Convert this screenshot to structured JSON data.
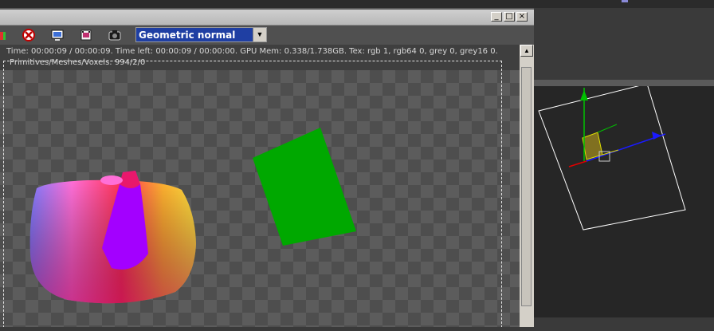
{
  "toolbar": {
    "display_mode": "Geometric normal",
    "icons": [
      "teapot-icon",
      "no-entry-icon",
      "monitor-icon",
      "film-clip-icon",
      "camera-icon"
    ]
  },
  "stats": {
    "line1": "Time: 00:00:09 / 00:00:09.   Time left: 00:00:09 / 00:00:00.   GPU Mem: 0.338/1.738GB.   Tex: rgb 1, rgb64 0, grey 0, grey16 0.",
    "line2": "Primitives/Meshes/Voxels: 994/2/0"
  },
  "colors": {
    "select_bg": "#1f3fa3",
    "green_plane": "#00a800",
    "viewport_bg": "#262626"
  }
}
